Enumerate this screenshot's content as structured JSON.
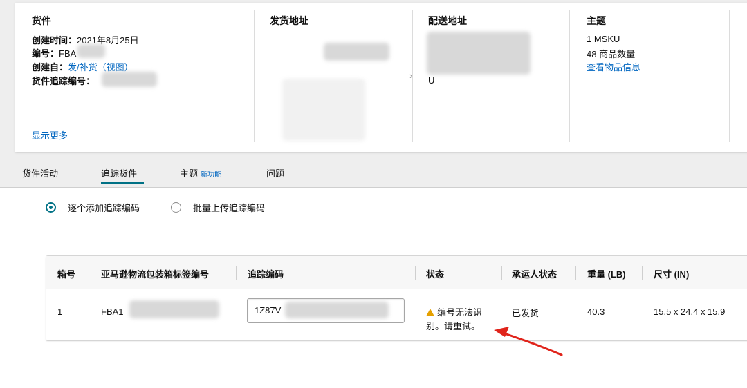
{
  "summary": {
    "shipment": {
      "title": "货件",
      "created_label": "创建时间：",
      "created_value": "2021年8月25日",
      "id_label": "编号：",
      "id_value": "FBA",
      "created_from_label": "创建自：",
      "created_from_value": "发/补货",
      "created_from_view": "（视图）",
      "tracking_label": "货件追踪编号：",
      "show_more": "显示更多"
    },
    "ship_from": {
      "title": "发货地址"
    },
    "ship_to": {
      "title": "配送地址",
      "partial_text": "U"
    },
    "contents": {
      "title": "主题",
      "msku": "1 MSKU",
      "units": "48 商品数量",
      "view_items": "查看物品信息"
    }
  },
  "tabs": [
    {
      "label": "货件活动"
    },
    {
      "label": "追踪货件",
      "active": true
    },
    {
      "label": "主题",
      "badge": "新功能"
    },
    {
      "label": "问题"
    }
  ],
  "radio_options": [
    {
      "label": "逐个添加追踪编码",
      "checked": true
    },
    {
      "label": "批量上传追踪编码",
      "checked": false
    }
  ],
  "table": {
    "headers": [
      "箱号",
      "亚马逊物流包装箱标签编号",
      "追踪编码",
      "状态",
      "承运人状态",
      "重量 (LB)",
      "尺寸 (IN)"
    ],
    "row": {
      "box_no": "1",
      "label_id": "FBA1",
      "tracking_code": "1Z87V",
      "status": "编号无法识别。请重试。",
      "carrier_status": "已发货",
      "weight": "40.3",
      "dimensions": "15.5 x 24.4 x 15.9"
    }
  },
  "colors": {
    "link": "#0066c0",
    "accent": "#007185",
    "warning": "#e5a000",
    "annotation_arrow": "#e0241b"
  }
}
